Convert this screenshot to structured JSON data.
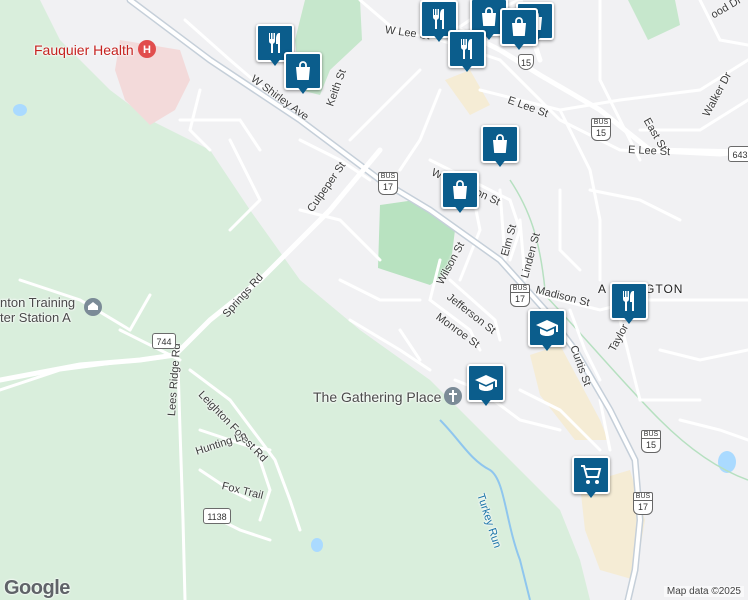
{
  "map": {
    "attribution": "Map data ©2025",
    "logo_text": "Google",
    "places": {
      "hospital": "Fauquier Health",
      "training_station": "nton Training",
      "training_station_2": "ter Station A",
      "church": "The Gathering Place",
      "town": "A",
      "town_rest": "GTON"
    },
    "streets": {
      "w_shirley": "W Shirley Ave",
      "keith": "Keith St",
      "culpeper": "Culpeper St",
      "w_lee": "W Lee St",
      "e_lee_1": "E Lee St",
      "e_lee_2": "E Lee St",
      "east": "East St",
      "walker": "Walker Dr",
      "wood": "ood Dr",
      "waterloo_w": "W",
      "waterloo_rest": "on St",
      "elm": "Elm St",
      "linden": "Linden St",
      "wilson": "Wilson St",
      "jefferson": "Jefferson St",
      "monroe": "Monroe St",
      "madison": "Madison St",
      "curtis": "Curtis St",
      "taylor": "Taylor",
      "springs": "Springs Rd",
      "lees_ridge": "Lees Ridge Rd",
      "leighton_forest": "Leighton Forest Rd",
      "hunting": "Hunting Ln",
      "fox": "Fox Trail",
      "turkey_run": "Turkey Run"
    },
    "route_shields": {
      "r744": "744",
      "r1138": "1138",
      "r643": "643",
      "bus17_a": {
        "top": "BUS",
        "num": "17"
      },
      "bus17_b": {
        "top": "BUS",
        "num": "17"
      },
      "bus17_c": {
        "top": "BUS",
        "num": "17"
      },
      "bus15_a": {
        "top": "BUS",
        "num": "15"
      },
      "bus15_b": {
        "top": "BUS",
        "num": "15"
      },
      "r15": "15"
    },
    "markers": [
      {
        "kind": "restaurant",
        "icon": "fork-knife-icon"
      },
      {
        "kind": "shopping",
        "icon": "shopping-bag-icon"
      },
      {
        "kind": "restaurant",
        "icon": "fork-knife-icon"
      },
      {
        "kind": "shopping",
        "icon": "shopping-bag-icon"
      },
      {
        "kind": "shopping",
        "icon": "shopping-bag-icon"
      },
      {
        "kind": "restaurant",
        "icon": "fork-knife-icon"
      },
      {
        "kind": "shopping",
        "icon": "shopping-bag-icon"
      },
      {
        "kind": "shopping",
        "icon": "shopping-bag-icon"
      },
      {
        "kind": "school",
        "icon": "graduation-cap-icon"
      },
      {
        "kind": "restaurant",
        "icon": "fork-knife-icon"
      },
      {
        "kind": "school",
        "icon": "graduation-cap-icon"
      },
      {
        "kind": "grocery",
        "icon": "shopping-cart-icon"
      }
    ],
    "colors": {
      "marker": "#0b5d8c",
      "park": "#cfe9d3",
      "forest": "#d9eedc",
      "water": "#aadaff",
      "road": "#ffffff",
      "highway": "#c5cfd9",
      "hospital": "#c5221f"
    }
  }
}
